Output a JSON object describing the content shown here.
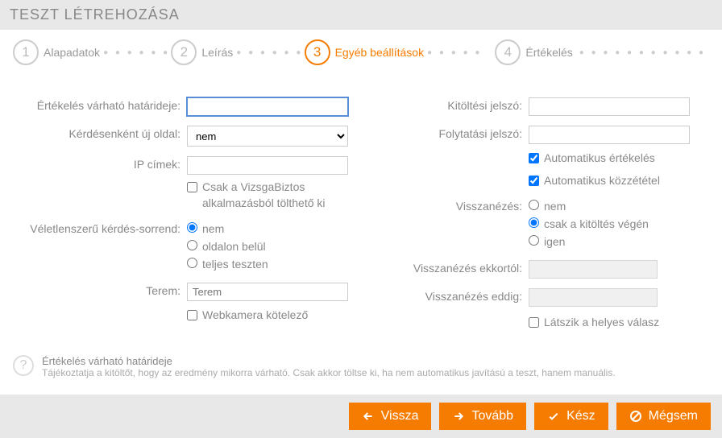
{
  "title": "TESZT LÉTREHOZÁSA",
  "steps": [
    {
      "num": "1",
      "label": "Alapadatok"
    },
    {
      "num": "2",
      "label": "Leírás"
    },
    {
      "num": "3",
      "label": "Egyéb beállítások"
    },
    {
      "num": "4",
      "label": "Értékelés"
    }
  ],
  "left": {
    "deadline_label": "Értékelés várható határideje:",
    "deadline_value": "",
    "newpage_label": "Kérdésenként új oldal:",
    "newpage_value": "nem",
    "ip_label": "IP címek:",
    "ip_value": "",
    "vizsgabiztos": "Csak a VizsgaBiztos alkalmazásból tölthető ki",
    "random_label": "Véletlenszerű kérdés-sorrend:",
    "random_opts": {
      "nem": "nem",
      "oldal": "oldalon belül",
      "teljes": "teljes teszten"
    },
    "room_label": "Terem:",
    "room_placeholder": "Terem",
    "webcam": "Webkamera kötelező"
  },
  "right": {
    "pass_label": "Kitöltési jelszó:",
    "cont_label": "Folytatási jelszó:",
    "auto_eval": "Automatikus értékelés",
    "auto_pub": "Automatikus közzététel",
    "lookback_label": "Visszanézés:",
    "lookback_opts": {
      "nem": "nem",
      "vegen": "csak a kitöltés végén",
      "igen": "igen"
    },
    "from_label": "Visszanézés ekkortól:",
    "until_label": "Visszanézés eddig:",
    "correct": "Látszik a helyes válasz"
  },
  "help": {
    "title": "Értékelés várható határideje",
    "text": "Tájékoztatja a kitöltőt, hogy az eredmény mikorra várható. Csak akkor töltse ki, ha nem automatikus javítású a teszt, hanem manuális."
  },
  "buttons": {
    "back": "Vissza",
    "next": "Tovább",
    "done": "Kész",
    "cancel": "Mégsem"
  }
}
